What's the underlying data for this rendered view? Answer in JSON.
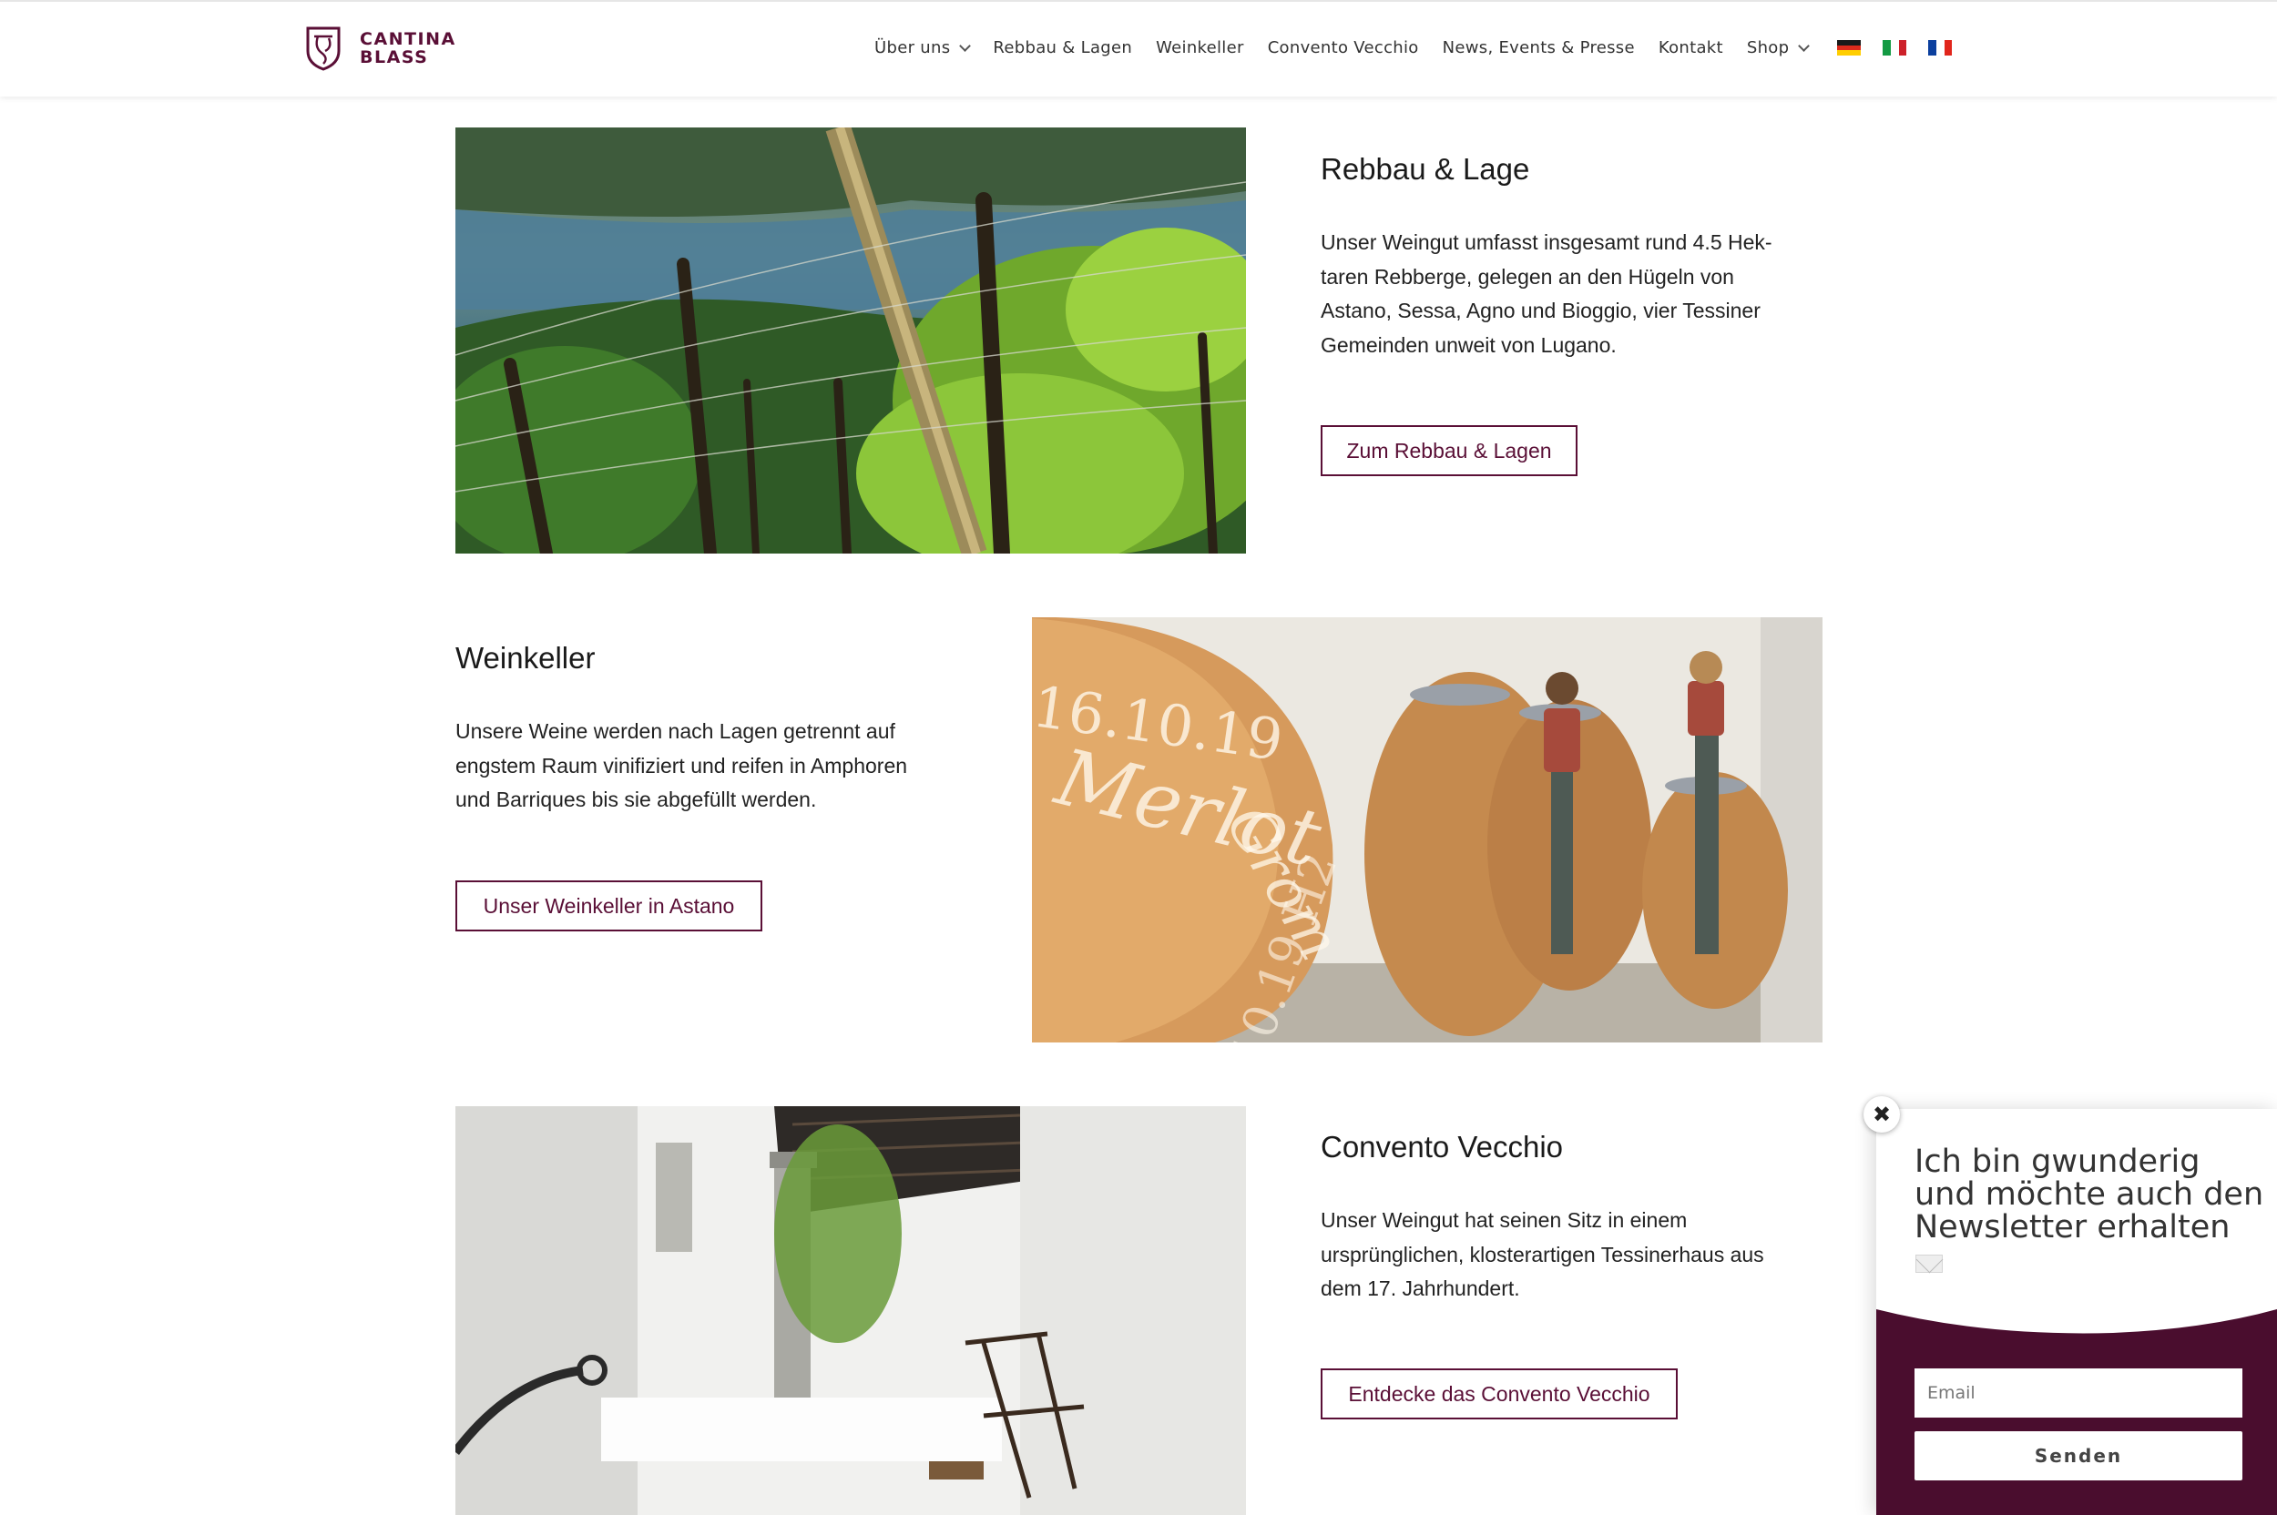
{
  "brand": {
    "line1": "CANTINA",
    "line2": "BLASS",
    "color": "#5a0f36"
  },
  "nav": {
    "items": [
      {
        "label": "Über uns",
        "dropdown": true
      },
      {
        "label": "Rebbau & Lagen",
        "dropdown": false
      },
      {
        "label": "Weinkeller",
        "dropdown": false
      },
      {
        "label": "Convento Vecchio",
        "dropdown": false
      },
      {
        "label": "News, Events & Presse",
        "dropdown": false
      },
      {
        "label": "Kontakt",
        "dropdown": false
      },
      {
        "label": "Shop",
        "dropdown": true
      }
    ],
    "languages": [
      "de-flag-icon",
      "it-flag-icon",
      "fr-flag-icon"
    ]
  },
  "sections": {
    "rebbau": {
      "title": "Rebbau & Lage",
      "text": "Unser Weingut umfasst insgesamt rund 4.5 Hek­taren Rebberge, gelegen an den Hügeln von Astano, Sessa, Agno und Bioggio, vier Tessiner Gemeinden unweit von Lugano.",
      "button": "Zum Rebbau & Lagen"
    },
    "weinkeller": {
      "title": "Weinkeller",
      "text": "Unsere Weine werden nach Lagen getrennt auf engstem Raum vinifiziert und reifen in Amphoren und Barriques bis sie abgefüllt werden.",
      "button": "Unser Weinkeller in Astano",
      "chalk": [
        "16.10.19",
        "Merlot",
        "Grom",
        "17.10.19 H2"
      ]
    },
    "convento": {
      "title": "Convento Vecchio",
      "text": "Unser Weingut hat seinen Sitz in einem ursprünglichen, klosterartigen Tessinerhaus aus dem 17. Jahrhundert.",
      "button": "Entdecke das Convento Vecchio"
    }
  },
  "newsletter": {
    "title": "Ich bin gwunderig und möchte auch den Newsletter erhalten",
    "email_placeholder": "Email",
    "submit": "Senden",
    "close": "✖",
    "bottom_color": "#4a0d2e"
  }
}
